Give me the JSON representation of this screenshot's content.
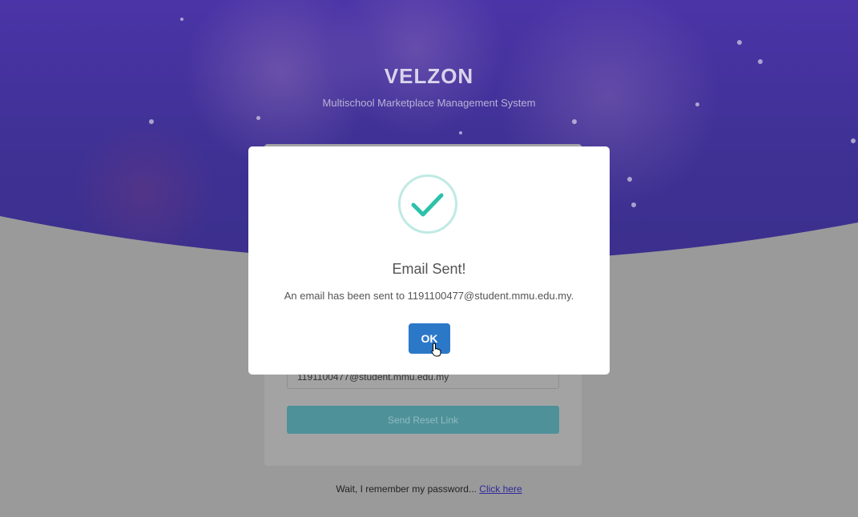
{
  "brand": {
    "name": "VELZON",
    "tagline": "Multischool Marketplace Management System"
  },
  "form": {
    "email_value": "1191100477@student.mmu.edu.my",
    "send_label": "Send Reset Link"
  },
  "footer": {
    "remember_text": "Wait, I remember my password...",
    "remember_link": "Click here"
  },
  "modal": {
    "icon": "success-check-icon",
    "title": "Email Sent!",
    "message": "An email has been sent to 1191100477@student.mmu.edu.my.",
    "ok_label": "OK"
  },
  "colors": {
    "accent": "#2c78c8",
    "success": "#2cc1a9",
    "hero": "#4b34a7"
  }
}
